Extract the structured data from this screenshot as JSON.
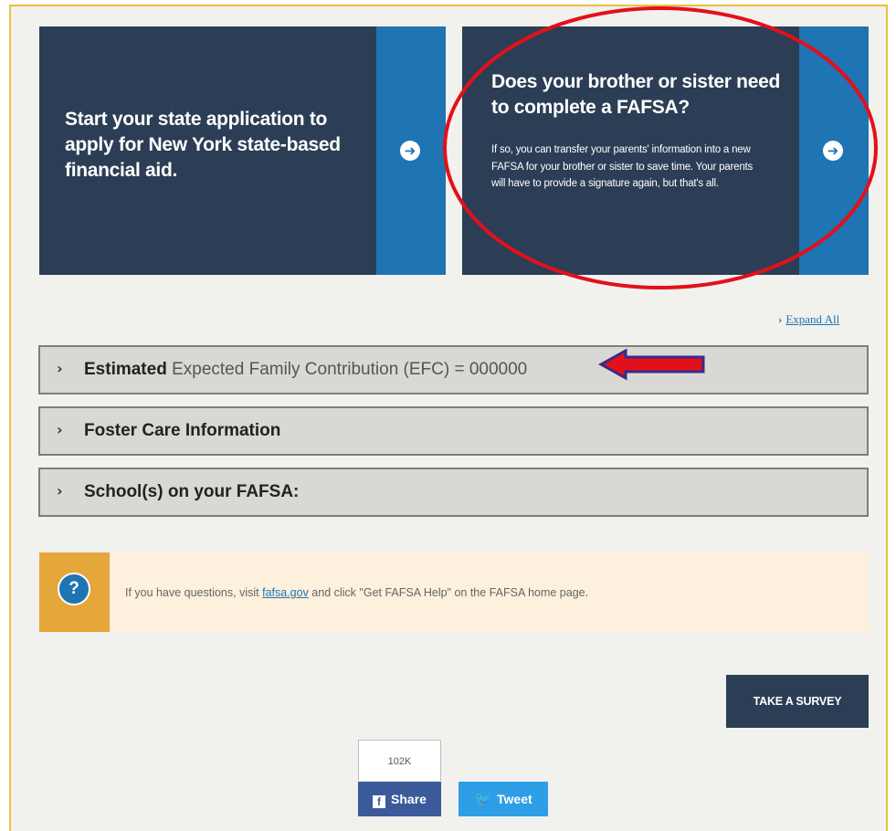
{
  "cards": [
    {
      "title": "Start your state application to apply for New York state-based financial aid.",
      "icon": "arrow-right-circle-icon"
    },
    {
      "title": "Does your brother or sister need to complete a FAFSA?",
      "body": "If so, you can transfer your parents' information into a new FAFSA for your brother or sister to save time. Your parents will have to provide a signature again, but that's all.",
      "icon": "arrow-right-circle-icon"
    }
  ],
  "expand_all": "Expand All",
  "accordion": [
    {
      "strong": "Estimated",
      "rest": " Expected Family Contribution (EFC) = 000000"
    },
    {
      "strong": "Foster Care Information",
      "rest": ""
    },
    {
      "strong": "School(s) on your FAFSA:",
      "rest": ""
    }
  ],
  "help": {
    "icon_glyph": "?",
    "text_before": "If you have questions, visit ",
    "link": "fafsa.gov",
    "text_after": " and click \"Get FAFSA Help\" on the FAFSA home page."
  },
  "survey_label": "TAKE A SURVEY",
  "social": {
    "count": "102K",
    "share_label": "Share",
    "tweet_label": "Tweet"
  },
  "colors": {
    "navy": "#2b3e55",
    "blue": "#1f74b3",
    "annotation_red": "#e3101b",
    "help_yellow": "#e5a63a"
  }
}
